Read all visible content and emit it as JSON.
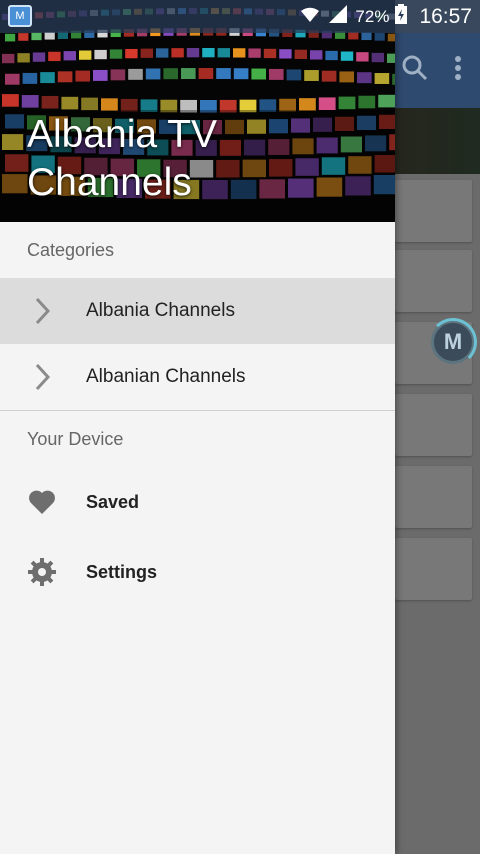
{
  "status_bar": {
    "app_icon_letter": "M",
    "battery": "72%",
    "time": "16:57"
  },
  "drawer": {
    "header_title": "Albania TV Channels",
    "sections": {
      "categories_label": "Categories",
      "device_label": "Your Device"
    },
    "categories": [
      {
        "label": "Albania Channels",
        "selected": true,
        "icon": "chevron-right-icon"
      },
      {
        "label": "Albanian Channels",
        "selected": false,
        "icon": "chevron-right-icon"
      }
    ],
    "device_items": [
      {
        "label": "Saved",
        "icon": "heart-icon"
      },
      {
        "label": "Settings",
        "icon": "gear-icon"
      }
    ]
  },
  "background_app": {
    "floating_badge_letter": "M",
    "toolbar_icons": [
      "search-icon",
      "overflow-menu-icon"
    ]
  },
  "colors": {
    "status_bar": "#283c58",
    "app_bar": "#2f4a6f",
    "drawer_bg": "#f4f4f4",
    "selected_item": "#dcdcdc",
    "scrim": "#6b6b6b"
  }
}
